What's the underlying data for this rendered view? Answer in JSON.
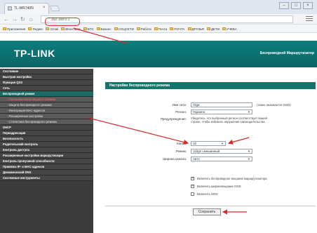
{
  "browser": {
    "tab_title": "TL-WR740N",
    "tab_close": "×",
    "url": "192.168.0.1",
    "window_controls": [
      "–",
      "□",
      "×"
    ],
    "bookmarks": [
      "Приложения",
      "Яндекс",
      "Gmail",
      "ВКонтакте",
      "BTC",
      "Бизнес",
      "СОЦСЕТИ",
      "Работа",
      "Почта",
      "ПОЧТА",
      "ДРУЗЬЯ",
      "ДЕТИ",
      "УЧЕБА"
    ]
  },
  "router": {
    "logo": "TP-LINK",
    "header_right": "Беспроводной Маршрутизатор",
    "sidebar_items": [
      {
        "label": "Состояние",
        "type": "main"
      },
      {
        "label": "Быстрая настройка",
        "type": "main"
      },
      {
        "label": "Функция QSS",
        "type": "main"
      },
      {
        "label": "Сеть",
        "type": "main"
      },
      {
        "label": "Беспроводной режим",
        "type": "active"
      },
      {
        "label": "- Настройки беспроводного режима",
        "type": "sub-current"
      },
      {
        "label": "- Защита беспроводного режима",
        "type": "sub"
      },
      {
        "label": "- Фильтрация MAC-адресов",
        "type": "sub"
      },
      {
        "label": "- Расширенные настройки",
        "type": "sub"
      },
      {
        "label": "- Статистика беспроводного режима",
        "type": "sub"
      },
      {
        "label": "DHCP",
        "type": "main"
      },
      {
        "label": "Переадресация",
        "type": "main"
      },
      {
        "label": "Безопасность",
        "type": "main"
      },
      {
        "label": "Родительский контроль",
        "type": "main"
      },
      {
        "label": "Контроль доступа",
        "type": "main"
      },
      {
        "label": "Расширенные настройки маршрутизации",
        "type": "main"
      },
      {
        "label": "Контроль пропускной способности",
        "type": "main"
      },
      {
        "label": "Привязка IP- и MAC-адресов",
        "type": "main"
      },
      {
        "label": "Динамический DNS",
        "type": "main"
      },
      {
        "label": "Системные инструменты",
        "type": "main"
      }
    ],
    "content_title": "Настройки беспроводного режима",
    "form": {
      "ssid_label": "Имя сети:",
      "ssid_value": "Olga",
      "ssid_hint": "(также называется SSID)",
      "region_label": "Регион:",
      "region_value": "Украина",
      "warning_label": "Предупреждение:",
      "warning_text": "Убедитесь, что выбранный регион соответствует вашей стране, чтобы избежать нарушения законодательства.",
      "channel_label": "Канал:",
      "channel_value": "10",
      "mode_label": "Режим:",
      "mode_value": "11bgn смешанный",
      "width_label": "Ширина канала:",
      "width_value": "Авто",
      "opt1": "Включить беспроводное вещание маршрутизатора",
      "opt2": "Включить широковещание SSID",
      "opt3": "Включить WDS",
      "save_label": "Сохранить"
    },
    "select_arrow": "▼"
  },
  "colors": {
    "header_teal": "#0d7d7d",
    "sidebar": "#3b3b3b",
    "active_item": "#1a6d66",
    "annotation_red": "#d62b2b"
  }
}
